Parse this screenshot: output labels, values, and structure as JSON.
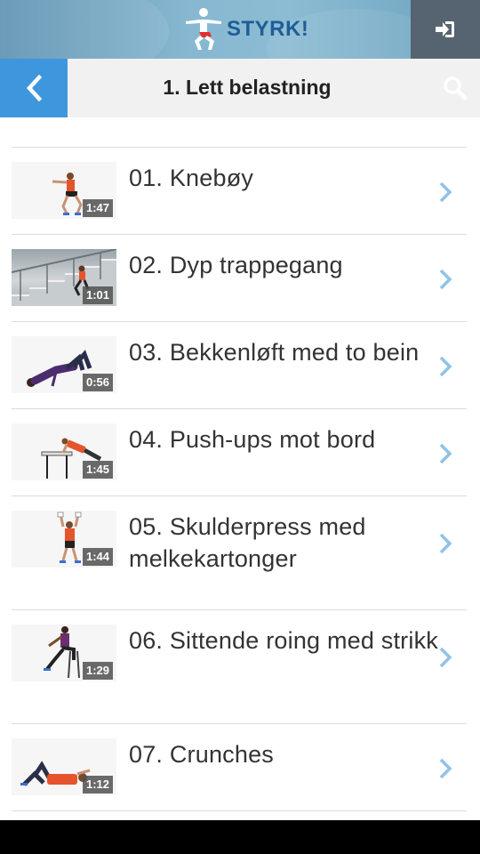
{
  "header": {
    "brand": "STYRK!",
    "login_icon": "login-icon"
  },
  "titlebar": {
    "title": "1. Lett belastning",
    "back_icon": "chevron-left-icon",
    "search_icon": "search-icon"
  },
  "exercises": [
    {
      "title": "01. Knebøy",
      "duration": "1:47"
    },
    {
      "title": "02. Dyp trappegang",
      "duration": "1:01"
    },
    {
      "title": "03. Bekkenløft med to bein",
      "duration": "0:56"
    },
    {
      "title": "04. Push-ups mot bord",
      "duration": "1:45"
    },
    {
      "title": "05. Skulderpress med melkekartonger",
      "duration": "1:44"
    },
    {
      "title": "06. Sittende roing med strikk",
      "duration": "1:29"
    },
    {
      "title": "07. Crunches",
      "duration": "1:12"
    }
  ],
  "colors": {
    "back_button": "#3e96dd",
    "login_button": "#566370",
    "brand_text": "#1d5e96",
    "chevron": "#8ec3e6"
  }
}
